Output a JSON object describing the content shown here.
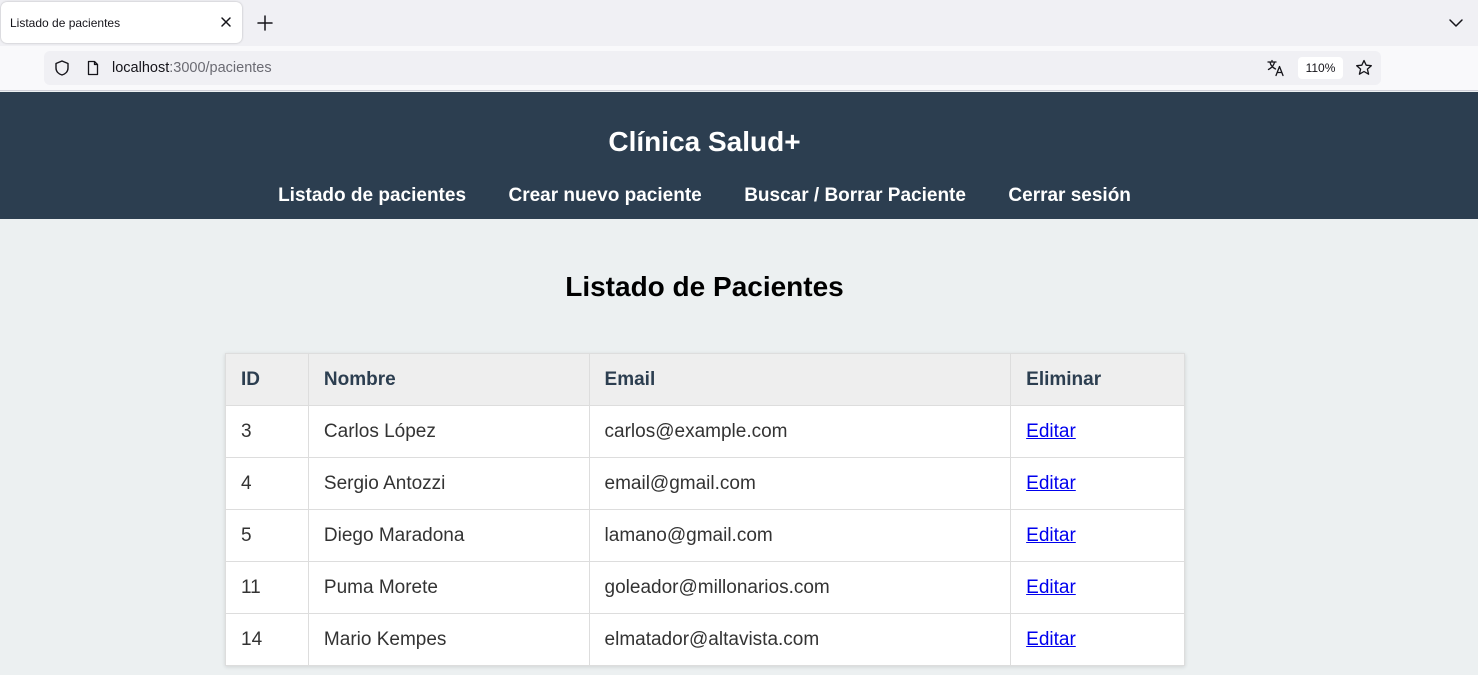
{
  "browser": {
    "tab_title": "Listado de pacientes",
    "url_host": "localhost",
    "url_path": ":3000/pacientes",
    "zoom": "110%"
  },
  "header": {
    "title": "Clínica Salud+",
    "nav": [
      {
        "label": "Listado de pacientes"
      },
      {
        "label": "Crear nuevo paciente"
      },
      {
        "label": "Buscar / Borrar Paciente"
      },
      {
        "label": "Cerrar sesión"
      }
    ]
  },
  "main": {
    "title": "Listado de Pacientes",
    "columns": [
      "ID",
      "Nombre",
      "Email",
      "Eliminar"
    ],
    "rows": [
      {
        "id": "3",
        "name": "Carlos López",
        "email": "carlos@example.com",
        "action": "Editar"
      },
      {
        "id": "4",
        "name": "Sergio Antozzi",
        "email": "email@gmail.com",
        "action": "Editar"
      },
      {
        "id": "5",
        "name": "Diego Maradona",
        "email": "lamano@gmail.com",
        "action": "Editar"
      },
      {
        "id": "11",
        "name": "Puma Morete",
        "email": "goleador@millonarios.com",
        "action": "Editar"
      },
      {
        "id": "14",
        "name": "Mario Kempes",
        "email": "elmatador@altavista.com",
        "action": "Editar"
      }
    ]
  },
  "colors": {
    "header_bg": "#2c3e50",
    "page_bg": "#ecf0f1",
    "link": "#0000ee"
  },
  "icons": [
    "close-icon",
    "plus-icon",
    "chevron-down-icon",
    "shield-icon",
    "page-icon",
    "translate-icon",
    "star-icon"
  ]
}
